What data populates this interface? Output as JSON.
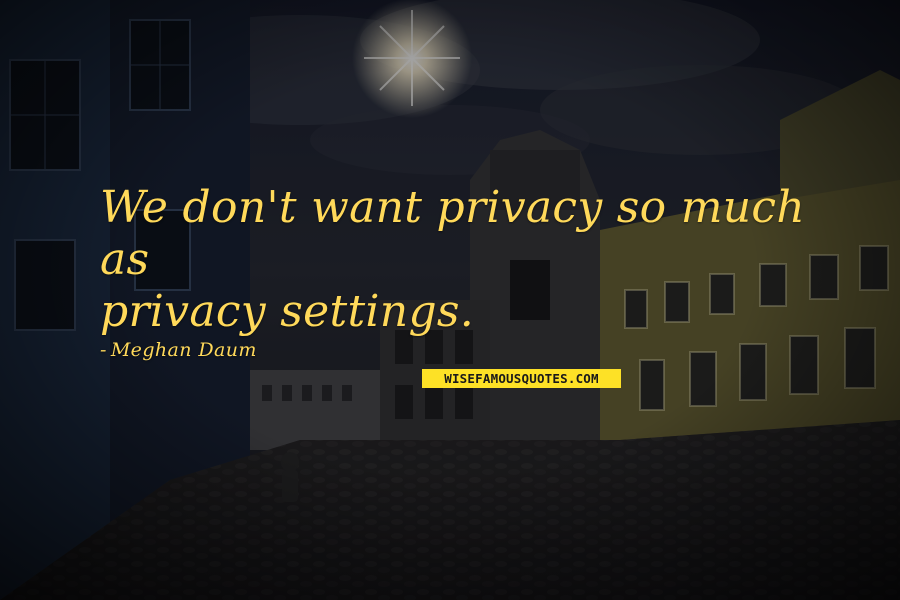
{
  "quote": {
    "text": "We don't want privacy so much as\nprivacy settings.",
    "author_dash": "-",
    "author": "Meghan Daum"
  },
  "watermark": {
    "text": "WISEFAMOUSQUOTES.COM"
  },
  "colors": {
    "quote_text": "#ffd95a",
    "watermark_bg": "#fde126",
    "watermark_text": "#1a1a1a"
  }
}
